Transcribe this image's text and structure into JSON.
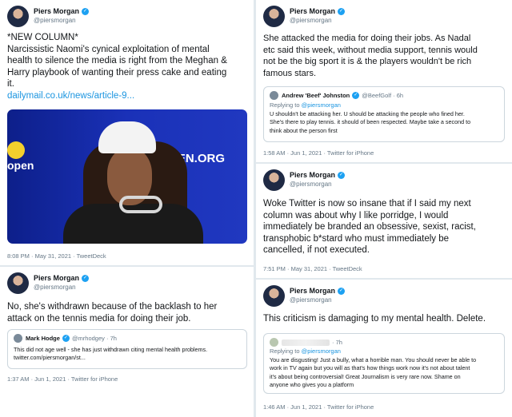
{
  "author": {
    "name": "Piers Morgan",
    "handle": "@piersmorgan"
  },
  "tweets": {
    "t1": {
      "line1": "*NEW COLUMN*",
      "line2": "Narcissistic Naomi's cynical exploitation of mental",
      "line3": "health to silence the media is right from the Meghan &",
      "line4": "Harry playbook of wanting their press cake and eating",
      "line5": "it.",
      "link": "dailymail.co.uk/news/article-9...",
      "photo_text": "SOPEN.ORG",
      "photo_text2": "open",
      "meta": "8:08 PM · May 31, 2021 · TweetDeck"
    },
    "t2": {
      "line1": "No, she's withdrawn because of the backlash to her",
      "line2": "attack on the tennis media for doing their job.",
      "quote": {
        "name": "Mark Hodge",
        "handle": "@mrhodgey · 7h",
        "line1": "This did not age well - she has just withdrawn citing mental health problems.",
        "line2": "twitter.com/piersmorgan/st..."
      },
      "meta": "1:37 AM · Jun 1, 2021 · Twitter for iPhone"
    },
    "t3": {
      "line1": "She attacked the media for doing their jobs. As Nadal",
      "line2": "etc said this week, without media support, tennis would",
      "line3": "not be the big sport it is & the players wouldn't be rich",
      "line4": "famous stars.",
      "quote": {
        "name": "Andrew 'Beef' Johnston",
        "handle": "@BeefGolf · 6h",
        "reply_prefix": "Replying to ",
        "reply_handle": "@piersmorgan",
        "line1": "U shouldn't be attacking her. U should be attacking the people who fined her.",
        "line2": "She's there to play tennis. it should of been respected. Maybe take a second to",
        "line3": "think about the person first"
      },
      "meta": "1:58 AM · Jun 1, 2021 · Twitter for iPhone"
    },
    "t4": {
      "line1": "Woke Twitter is now so insane that if I said my next",
      "line2": "column was about why I like porridge, I would",
      "line3": "immediately be branded an obsessive, sexist, racist,",
      "line4": "transphobic b*stard who must immediately be",
      "line5": "cancelled, if not executed.",
      "meta": "7:51 PM · May 31, 2021 · TweetDeck"
    },
    "t5": {
      "line1": "This criticism is damaging to  my mental health. Delete.",
      "quote": {
        "handle": "· 7h",
        "reply_prefix": "Replying to ",
        "reply_handle": "@piersmorgan",
        "line1": "You are disgusting! Just a bully, what a horrible man. You should never be able to",
        "line2": "work in TV again but you will as that's how things work now it's not about talent",
        "line3": "it's about being controversial! Great Journalism is very rare now. Shame on",
        "line4": "anyone who gives you a platform"
      },
      "meta": "1:46 AM · Jun 1, 2021 · Twitter for iPhone"
    }
  }
}
